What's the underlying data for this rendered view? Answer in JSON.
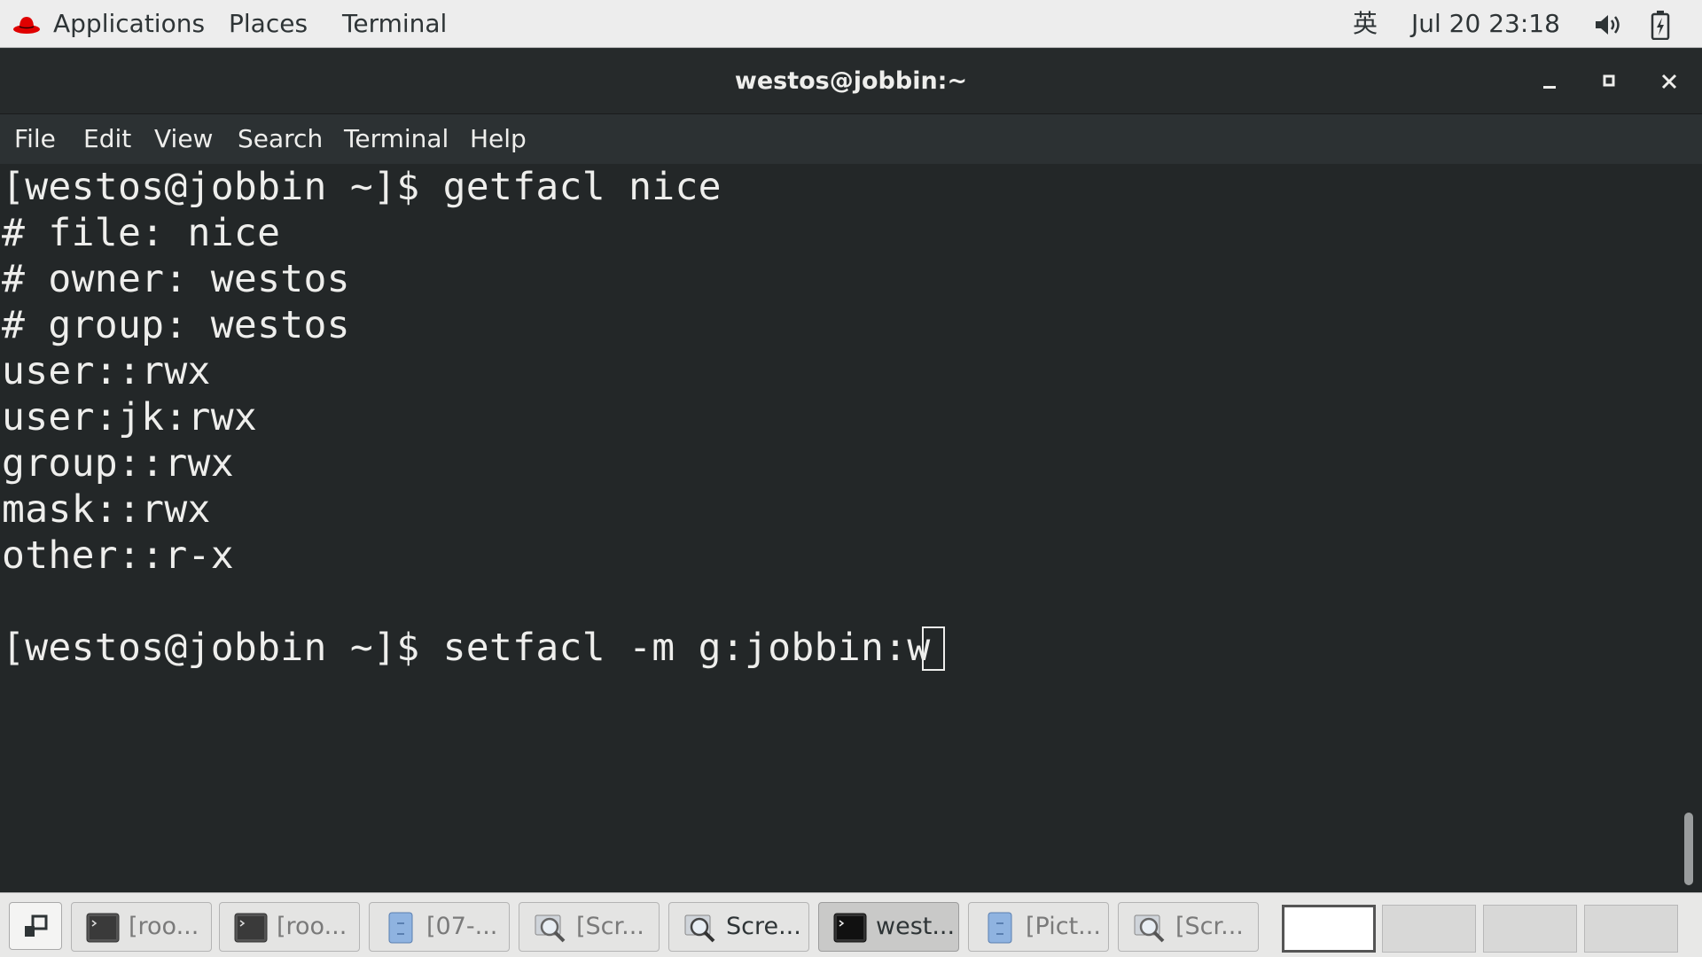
{
  "topbar": {
    "applications": "Applications",
    "places": "Places",
    "terminal": "Terminal",
    "ime": "英",
    "clock": "Jul 20  23:18"
  },
  "window": {
    "title": "westos@jobbin:~"
  },
  "menu": {
    "file": "File",
    "edit": "Edit",
    "view": "View",
    "search": "Search",
    "terminal": "Terminal",
    "help": "Help"
  },
  "terminal": {
    "lines": [
      "[westos@jobbin ~]$ getfacl nice",
      "# file: nice",
      "# owner: westos",
      "# group: westos",
      "user::rwx",
      "user:jk:rwx",
      "group::rwx",
      "mask::rwx",
      "other::r-x",
      "",
      "[westos@jobbin ~]$ setfacl -m g:jobbin:w"
    ]
  },
  "taskbar": {
    "tasks": [
      {
        "label": "[roo...",
        "icon": "terminal-icon"
      },
      {
        "label": "[roo...",
        "icon": "terminal-icon"
      },
      {
        "label": "[07-...",
        "icon": "file-manager-icon"
      },
      {
        "label": "[Scr...",
        "icon": "screenshot-icon"
      },
      {
        "label": "Scre...",
        "icon": "screenshot-icon"
      },
      {
        "label": "west...",
        "icon": "terminal-icon"
      },
      {
        "label": "[Pict...",
        "icon": "file-manager-icon"
      },
      {
        "label": "[Scr...",
        "icon": "screenshot-icon"
      }
    ],
    "active_index": 5,
    "workspaces": 4,
    "current_workspace": 0
  },
  "colors": {
    "terminal_bg": "#232728",
    "terminal_fg": "#eeeeec",
    "titlebar_bg": "#262a2b",
    "topbar_bg": "#ededed",
    "redhat_red": "#e00000"
  }
}
